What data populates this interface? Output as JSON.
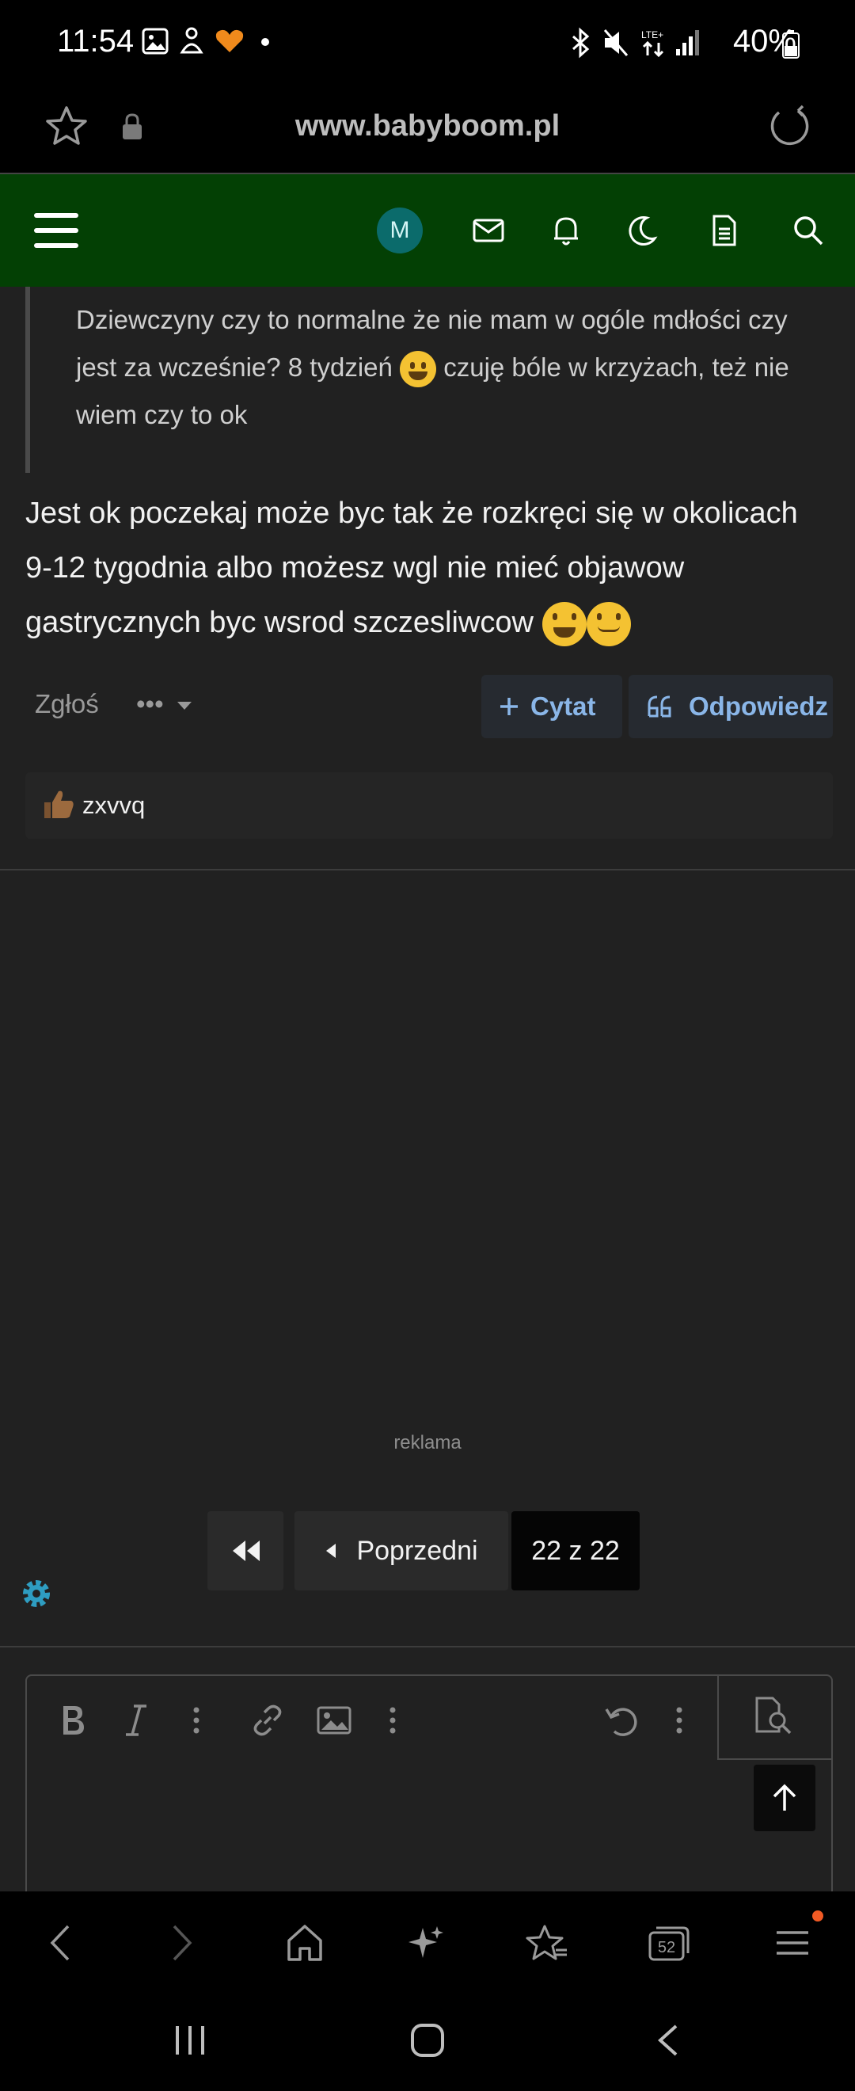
{
  "status_bar": {
    "time": "11:54",
    "battery": "40%"
  },
  "browser": {
    "url": "www.babyboom.pl"
  },
  "site_nav": {
    "avatar_letter": "M"
  },
  "quote": {
    "text_part1": "Dziewczyny czy to normalne że nie mam w ogóle mdłości czy jest za wcześnie? 8 tydzień",
    "text_part2": "czuję bóle w krzyżach, też nie wiem czy to ok"
  },
  "post": {
    "text": "Jest ok poczekaj może byc tak że rozkręci się w okolicach 9-12 tygodnia albo możesz wgl nie mieć objawow gastrycznych byc wsrod szczesliwcow"
  },
  "actions": {
    "report": "Zgłoś",
    "more": "•••",
    "quote": "Cytat",
    "reply": "Odpowiedz"
  },
  "reaction": {
    "user": "zxvvq"
  },
  "ad": {
    "label": "reklama"
  },
  "pagination": {
    "prev": "Poprzedni",
    "page": "22 z 22"
  },
  "bottom_badge": {
    "tabs": "52"
  },
  "colors": {
    "nav_green": "#034004",
    "accent_blue": "#8ab6e8",
    "avatar_teal": "#0b6b6b",
    "gear": "#2e9dc1"
  }
}
